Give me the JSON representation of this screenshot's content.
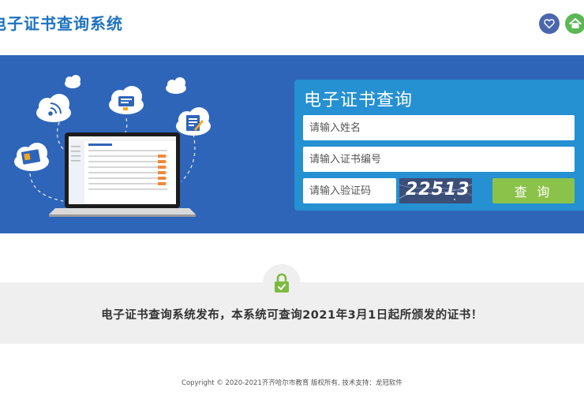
{
  "header": {
    "site_title": "电子证书查询系统",
    "icons": [
      "heart-icon",
      "home-icon"
    ]
  },
  "query_panel": {
    "title": "电子证书查询",
    "name_placeholder": "请输入姓名",
    "cert_placeholder": "请输入证书编号",
    "captcha_placeholder": "请输入验证码",
    "captcha_code": "22513",
    "query_button": "查 询"
  },
  "notice": {
    "text": "电子证书查询系统发布，本系统可查询2021年3月1日起所颁发的证书！"
  },
  "footer": {
    "copyright": "Copyright © 2020-2021齐齐哈尔市教育 版权所有, 技术支持：龙冠软件"
  },
  "colors": {
    "brand_blue": "#2e65b9",
    "panel_blue": "#2590d2",
    "button_green": "#8bc34a",
    "title_blue": "#1e73be"
  }
}
